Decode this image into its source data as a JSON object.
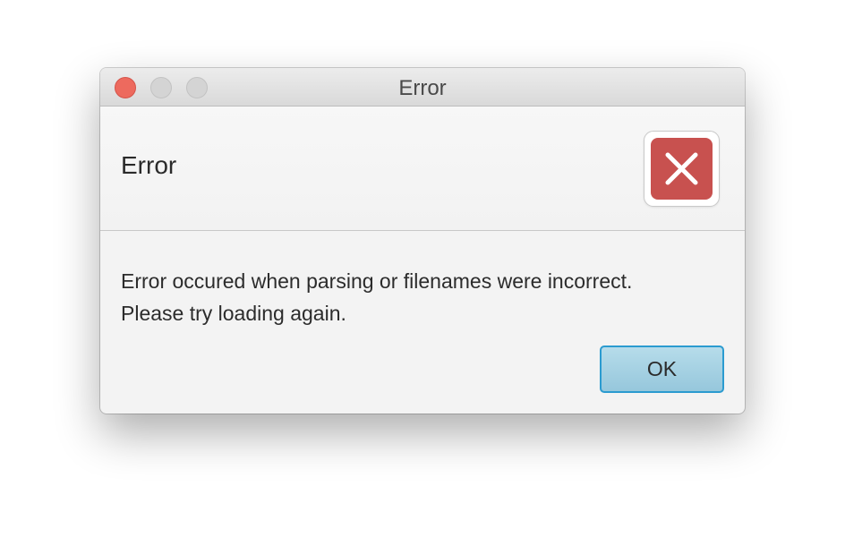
{
  "window": {
    "title": "Error"
  },
  "dialog": {
    "header_text": "Error",
    "icon": "error-x-icon",
    "message_line1": "Error occured when parsing or filenames were incorrect.",
    "message_line2": "Please try loading again.",
    "ok_label": "OK"
  },
  "colors": {
    "close_button": "#ed6a5e",
    "error_icon": "#c8514f",
    "ok_button_border": "#2b9bd0",
    "ok_button_fill": "#a6d2e4"
  }
}
